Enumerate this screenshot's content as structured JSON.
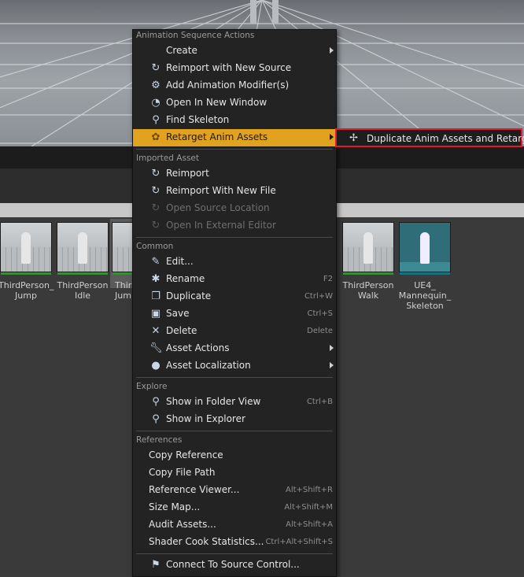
{
  "assets": [
    {
      "label": "ThirdPerson_\nJump"
    },
    {
      "label": "ThirdPerson\nIdle"
    },
    {
      "label": "Thir\nJum"
    },
    {
      "label": "ThirdPerson\nWalk"
    },
    {
      "label": "UE4_\nMannequin_\nSkeleton"
    }
  ],
  "menu": {
    "sections": {
      "anim": "Animation Sequence Actions",
      "imported": "Imported Asset",
      "common": "Common",
      "explore": "Explore",
      "references": "References"
    },
    "items": {
      "create": "Create",
      "reimport_new_source": "Reimport with New Source",
      "add_anim_modifier": "Add Animation Modifier(s)",
      "open_new_window": "Open In New Window",
      "find_skeleton": "Find Skeleton",
      "retarget": "Retarget Anim Assets",
      "reimport": "Reimport",
      "reimport_new_file": "Reimport With New File",
      "open_source_location": "Open Source Location",
      "open_external_editor": "Open In External Editor",
      "edit": "Edit...",
      "rename": "Rename",
      "duplicate": "Duplicate",
      "save": "Save",
      "delete": "Delete",
      "asset_actions": "Asset Actions",
      "asset_localization": "Asset Localization",
      "show_folder_view": "Show in Folder View",
      "show_explorer": "Show in Explorer",
      "copy_reference": "Copy Reference",
      "copy_file_path": "Copy File Path",
      "reference_viewer": "Reference Viewer...",
      "size_map": "Size Map...",
      "audit_assets": "Audit Assets...",
      "shader_cook_stats": "Shader Cook Statistics...",
      "connect_source_control": "Connect To Source Control..."
    },
    "shortcuts": {
      "rename": "F2",
      "duplicate": "Ctrl+W",
      "save": "Ctrl+S",
      "delete": "Delete",
      "show_folder_view": "Ctrl+B",
      "reference_viewer": "Alt+Shift+R",
      "size_map": "Alt+Shift+M",
      "audit_assets": "Alt+Shift+A",
      "shader_cook_stats": "Ctrl+Alt+Shift+S"
    }
  },
  "submenu": {
    "duplicate_retarget": "Duplicate Anim Assets and Retarget"
  },
  "colors": {
    "highlight": "#e1a21f",
    "callout_border": "#e01c2a",
    "menu_bg": "#232323"
  }
}
